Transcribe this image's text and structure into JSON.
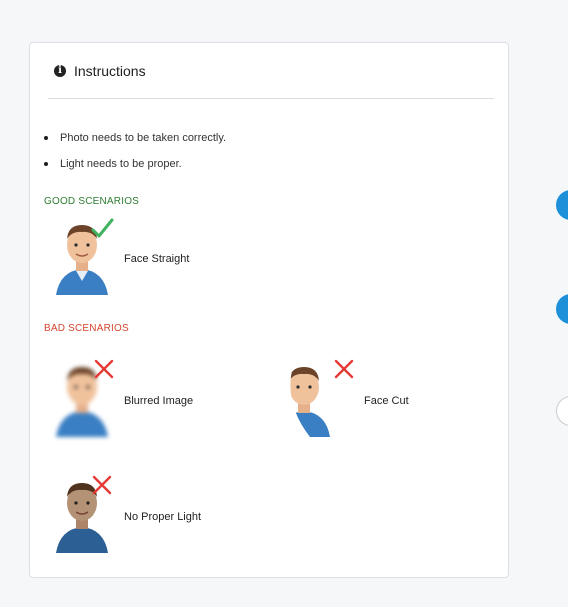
{
  "instructions": {
    "title": "Instructions",
    "bullets": [
      "Photo needs to be taken correctly.",
      "Light needs to be proper."
    ],
    "good_heading": "GOOD SCENARIOS",
    "bad_heading": "BAD SCENARIOS",
    "good_scenarios": [
      {
        "label": "Face Straight"
      }
    ],
    "bad_scenarios": [
      {
        "label": "Blurred Image"
      },
      {
        "label": "Face Cut"
      },
      {
        "label": "No Proper Light"
      }
    ]
  },
  "colors": {
    "good": "#2e7d32",
    "bad": "#d6452e",
    "check": "#3fb35f",
    "cross": "#e53935",
    "side_accent": "#1e90d9"
  },
  "icons": [
    "info-icon",
    "check-icon",
    "cross-icon"
  ]
}
